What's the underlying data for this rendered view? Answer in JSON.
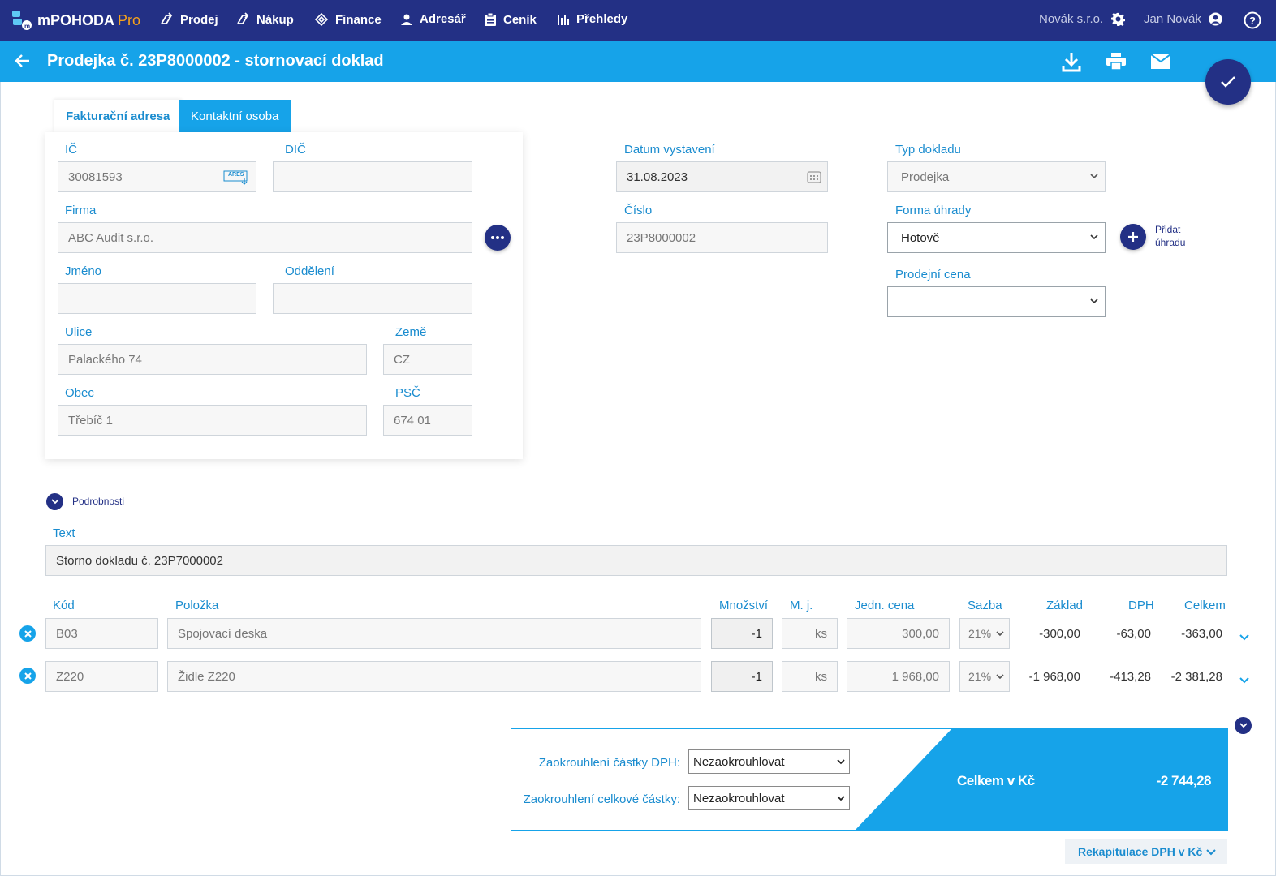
{
  "nav": {
    "logo_text": "mPOHODA",
    "logo_pro": "Pro",
    "items": [
      {
        "label": "Prodej",
        "icon": "sales-icon"
      },
      {
        "label": "Nákup",
        "icon": "purchase-icon"
      },
      {
        "label": "Finance",
        "icon": "finance-icon"
      },
      {
        "label": "Adresář",
        "icon": "person-icon"
      },
      {
        "label": "Ceník",
        "icon": "clipboard-icon"
      },
      {
        "label": "Přehledy",
        "icon": "chart-icon"
      }
    ],
    "company": "Novák s.r.o.",
    "user": "Jan Novák"
  },
  "header": {
    "title": "Prodejka č. 23P8000002 - stornovací doklad"
  },
  "tabs": {
    "billing": "Fakturační adresa",
    "contact": "Kontaktní osoba"
  },
  "address": {
    "ic_label": "IČ",
    "ic_value": "30081593",
    "ares_label": "ARES",
    "dic_label": "DIČ",
    "dic_value": "",
    "firma_label": "Firma",
    "firma_value": "ABC Audit s.r.o.",
    "jmeno_label": "Jméno",
    "jmeno_value": "",
    "oddeleni_label": "Oddělení",
    "oddeleni_value": "",
    "ulice_label": "Ulice",
    "ulice_value": "Palackého 74",
    "zeme_label": "Země",
    "zeme_value": "CZ",
    "obec_label": "Obec",
    "obec_value": "Třebíč 1",
    "psc_label": "PSČ",
    "psc_value": "674 01"
  },
  "doc": {
    "datum_label": "Datum vystavení",
    "datum_value": "31.08.2023",
    "cislo_label": "Číslo",
    "cislo_value": "23P8000002",
    "typ_label": "Typ dokladu",
    "typ_value": "Prodejka",
    "forma_label": "Forma úhrady",
    "forma_value": "Hotově",
    "pridat_label_1": "Přidat",
    "pridat_label_2": "úhradu",
    "cena_label": "Prodejní cena",
    "cena_value": ""
  },
  "details": {
    "toggle_label": "Podrobnosti",
    "text_label": "Text",
    "text_value": "Storno dokladu č. 23P7000002"
  },
  "columns": {
    "kod": "Kód",
    "polozka": "Položka",
    "mnozstvi": "Množství",
    "mj": "M. j.",
    "jedn_cena": "Jedn. cena",
    "sazba": "Sazba",
    "zaklad": "Základ",
    "dph": "DPH",
    "celkem": "Celkem"
  },
  "rows": [
    {
      "kod": "B03",
      "polozka": "Spojovací deska",
      "mnozstvi": "-1",
      "mj": "ks",
      "jedn_cena": "300,00",
      "sazba": "21%",
      "zaklad": "-300,00",
      "dph": "-63,00",
      "celkem": "-363,00"
    },
    {
      "kod": "Z220",
      "polozka": "Židle Z220",
      "mnozstvi": "-1",
      "mj": "ks",
      "jedn_cena": "1 968,00",
      "sazba": "21%",
      "zaklad": "-1 968,00",
      "dph": "-413,28",
      "celkem": "-2 381,28"
    }
  ],
  "totals": {
    "round_dph_label": "Zaokrouhlení částky DPH:",
    "round_dph_value": "Nezaokrouhlovat",
    "round_total_label": "Zaokrouhlení celkové částky:",
    "round_total_value": "Nezaokrouhlovat",
    "total_label": "Celkem v Kč",
    "total_value": "-2 744,28",
    "recap_label": "Rekapitulace DPH v Kč"
  },
  "colors": {
    "nav": "#233085",
    "accent": "#16a3e9",
    "label": "#1a8ccf",
    "logo_pro": "#f7a21b"
  }
}
